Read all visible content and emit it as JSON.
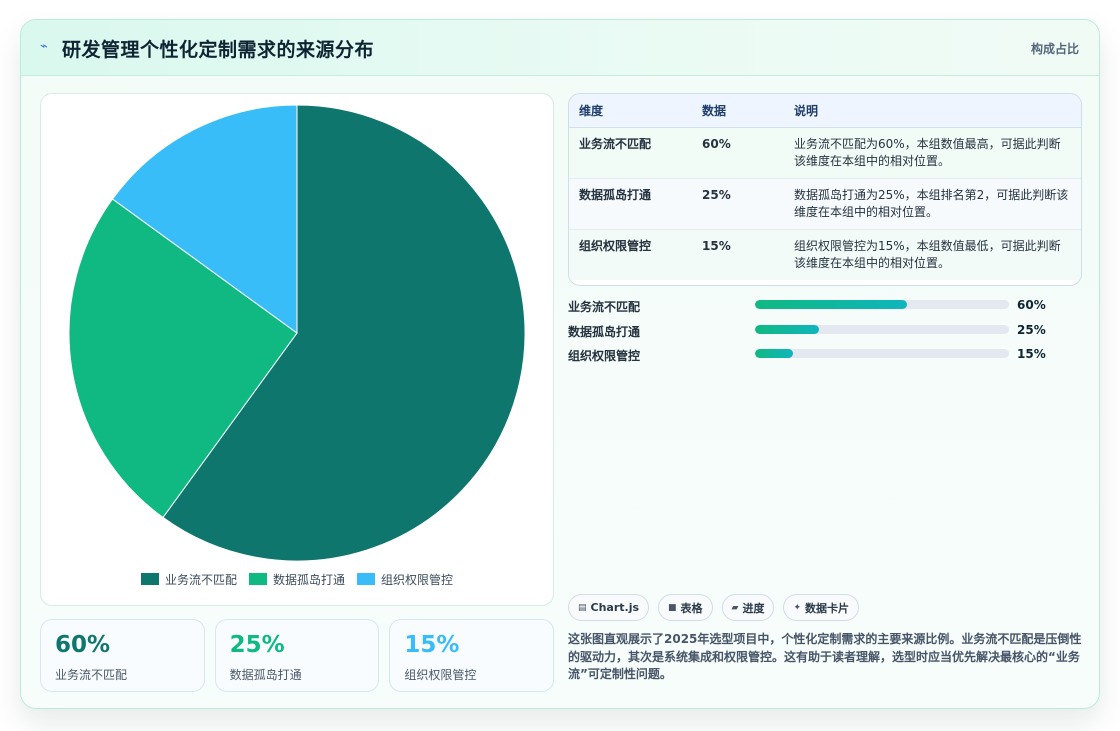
{
  "header": {
    "icon": "lightning-icon",
    "title": "研发管理个性化定制需求的来源分布",
    "subtitle": "构成占比"
  },
  "chart_data": {
    "type": "pie",
    "categories": [
      "业务流不匹配",
      "数据孤岛打通",
      "组织权限管控"
    ],
    "values": [
      60,
      25,
      15
    ],
    "colors": [
      "#0f766e",
      "#10b981",
      "#38bdf8"
    ],
    "legend_position": "bottom"
  },
  "stats": [
    {
      "value": "60%",
      "label": "业务流不匹配",
      "color": "#0f766e"
    },
    {
      "value": "25%",
      "label": "数据孤岛打通",
      "color": "#10b981"
    },
    {
      "value": "15%",
      "label": "组织权限管控",
      "color": "#38bdf8"
    }
  ],
  "table": {
    "headers": [
      "维度",
      "数据",
      "说明"
    ],
    "rows": [
      {
        "dim": "业务流不匹配",
        "val": "60%",
        "desc": "业务流不匹配为60%，本组数值最高，可据此判断该维度在本组中的相对位置。"
      },
      {
        "dim": "数据孤岛打通",
        "val": "25%",
        "desc": "数据孤岛打通为25%，本组排名第2，可据此判断该维度在本组中的相对位置。"
      },
      {
        "dim": "组织权限管控",
        "val": "15%",
        "desc": "组织权限管控为15%，本组数值最低，可据此判断该维度在本组中的相对位置。"
      }
    ]
  },
  "progress": [
    {
      "label": "业务流不匹配",
      "value": 60,
      "text": "60%"
    },
    {
      "label": "数据孤岛打通",
      "value": 25,
      "text": "25%"
    },
    {
      "label": "组织权限管控",
      "value": 15,
      "text": "15%"
    }
  ],
  "tags": [
    {
      "icon": "chart-icon",
      "glyph": "▤",
      "label": "Chart.js"
    },
    {
      "icon": "table-icon",
      "glyph": "■",
      "label": "表格"
    },
    {
      "icon": "progress-icon",
      "glyph": "▰",
      "label": "进度"
    },
    {
      "icon": "card-icon",
      "glyph": "✦",
      "label": "数据卡片"
    }
  ],
  "note": "这张图直观展示了2025年选型项目中，个性化定制需求的主要来源比例。业务流不匹配是压倒性的驱动力，其次是系统集成和权限管控。这有助于读者理解，选型时应当优先解决最核心的“业务流”可定制性问题。"
}
